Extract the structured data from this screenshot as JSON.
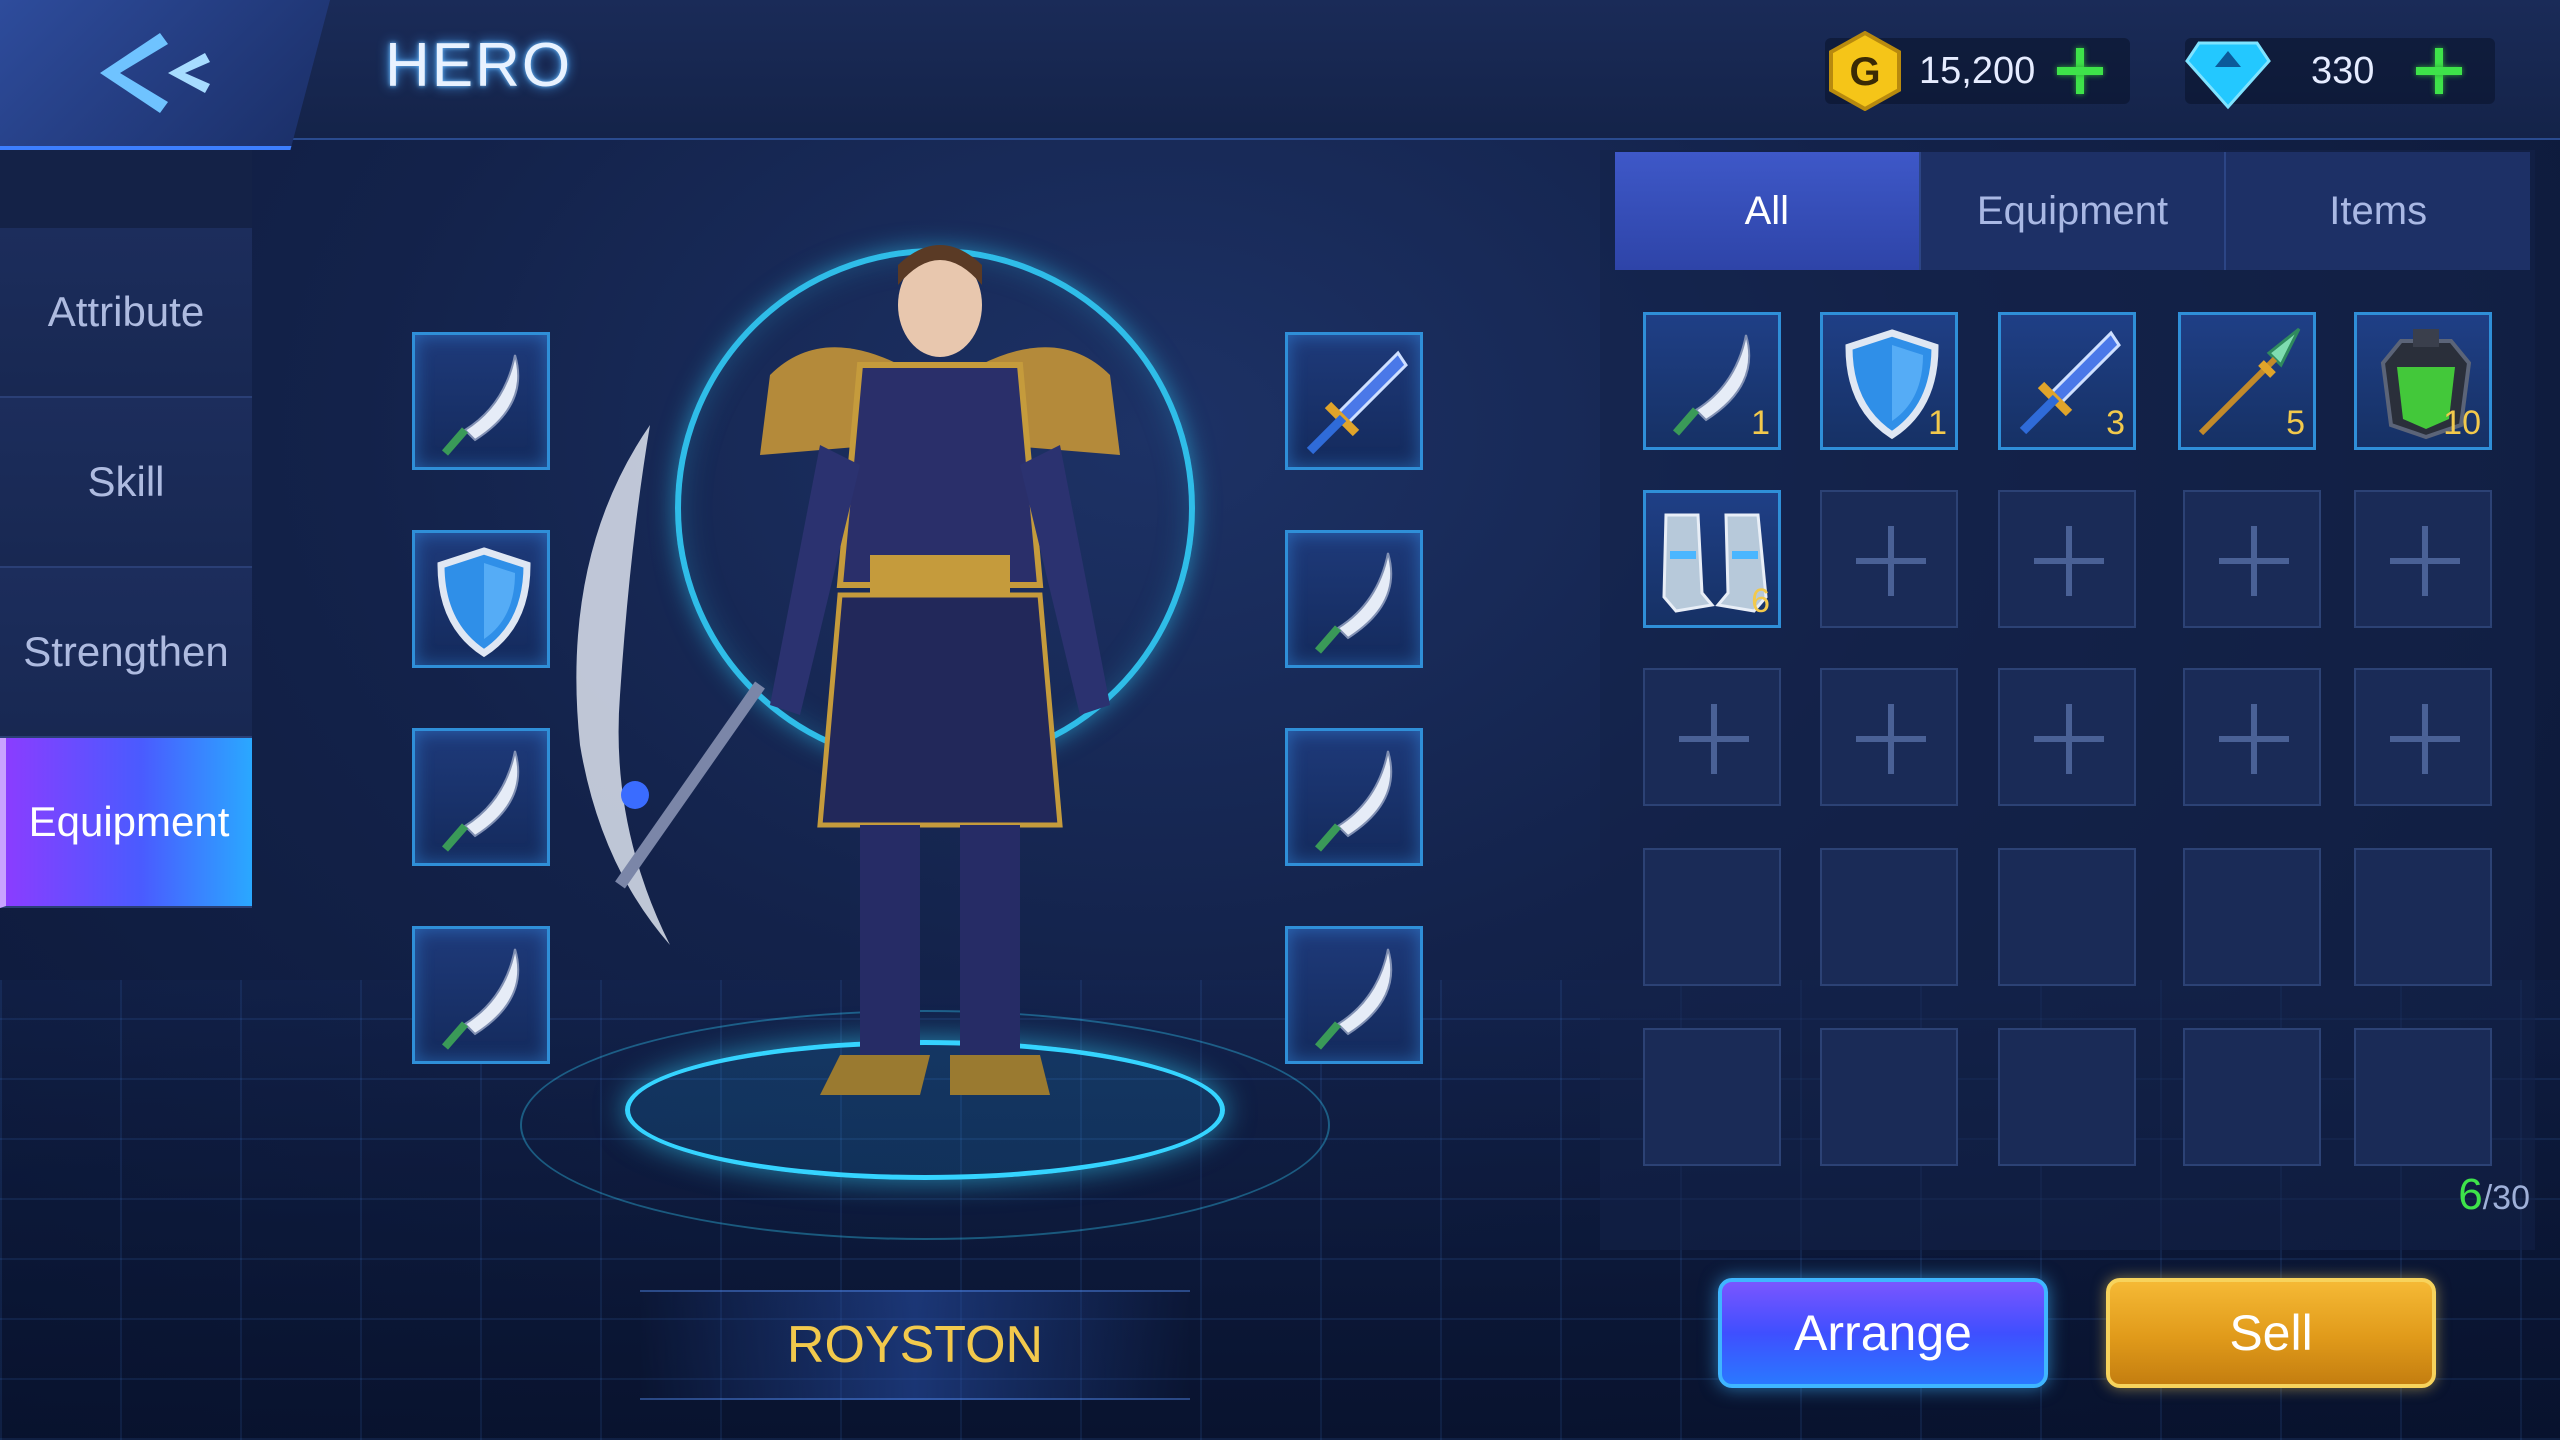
{
  "header": {
    "title": "HERO",
    "gold": {
      "icon": "gold-coin-icon",
      "letter": "G",
      "value": "15,200"
    },
    "diamond": {
      "icon": "diamond-icon",
      "value": "330"
    }
  },
  "sidebar": {
    "items": [
      {
        "label": "Attribute",
        "active": false
      },
      {
        "label": "Skill",
        "active": false
      },
      {
        "label": "Strengthen",
        "active": false
      },
      {
        "label": "Equipment",
        "active": true
      }
    ]
  },
  "hero": {
    "name": "ROYSTON",
    "left_slots": [
      "dagger-icon",
      "shield-icon",
      "dagger-icon",
      "dagger-icon"
    ],
    "right_slots": [
      "sword-icon",
      "dagger-icon",
      "dagger-icon",
      "dagger-icon"
    ]
  },
  "inventory": {
    "tabs": [
      {
        "label": "All",
        "active": true
      },
      {
        "label": "Equipment",
        "active": false
      },
      {
        "label": "Items",
        "active": false
      }
    ],
    "items": [
      {
        "icon": "dagger-icon",
        "qty": "1"
      },
      {
        "icon": "shield-icon",
        "qty": "1"
      },
      {
        "icon": "sword-icon",
        "qty": "3"
      },
      {
        "icon": "spear-icon",
        "qty": "5"
      },
      {
        "icon": "armor-icon",
        "qty": "10"
      },
      {
        "icon": "boots-icon",
        "qty": "6"
      }
    ],
    "capacity": {
      "current": "6",
      "separator": "/",
      "max": "30"
    }
  },
  "buttons": {
    "arrange": "Arrange",
    "sell": "Sell"
  },
  "colors": {
    "accent_blue": "#2f8fd8",
    "gold_text": "#f2c94c",
    "green_plus": "#3ee34a",
    "active_tab": "#8a3dff"
  }
}
